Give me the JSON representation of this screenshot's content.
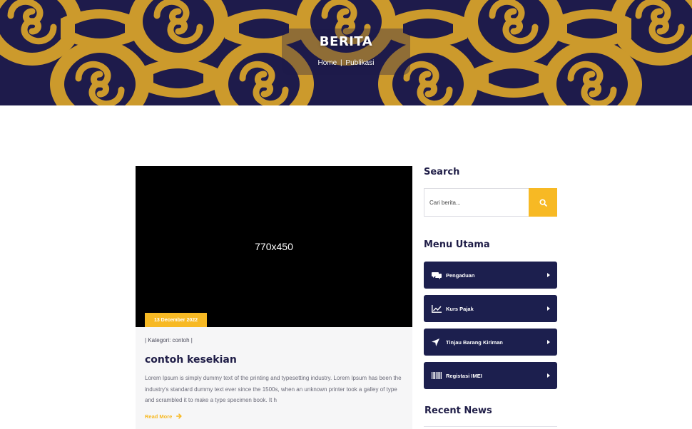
{
  "hero": {
    "title": "BERITA",
    "breadcrumb": {
      "home": "Home",
      "separator": "|",
      "current": "Publikasi"
    }
  },
  "post": {
    "image_placeholder": "770x450",
    "date": "13 December 2022",
    "meta": "| Kategori: contoh |",
    "title": "contoh kesekian",
    "excerpt": "Lorem Ipsum is simply dummy text of the printing and typesetting industry. Lorem Ipsum has been the industry's standard dummy text ever since the 1500s, when an unknown printer took a galley of type and scrambled it to make a type specimen book. It h",
    "read_more": "Read More"
  },
  "sidebar": {
    "search": {
      "title": "Search",
      "placeholder": "Cari berita..."
    },
    "menu": {
      "title": "Menu Utama",
      "items": [
        {
          "label": "Pengaduan",
          "icon": "comments-icon"
        },
        {
          "label": "Kurs Pajak",
          "icon": "chart-line-icon"
        },
        {
          "label": "Tinjau Barang Kiriman",
          "icon": "location-arrow-icon"
        },
        {
          "label": "Registasi IMEI",
          "icon": "barcode-icon"
        }
      ]
    },
    "recent": {
      "title": "Recent News"
    }
  },
  "colors": {
    "navy": "#1c1f4e",
    "gold": "#f7b924",
    "hero_pattern": "#d4a12f"
  }
}
